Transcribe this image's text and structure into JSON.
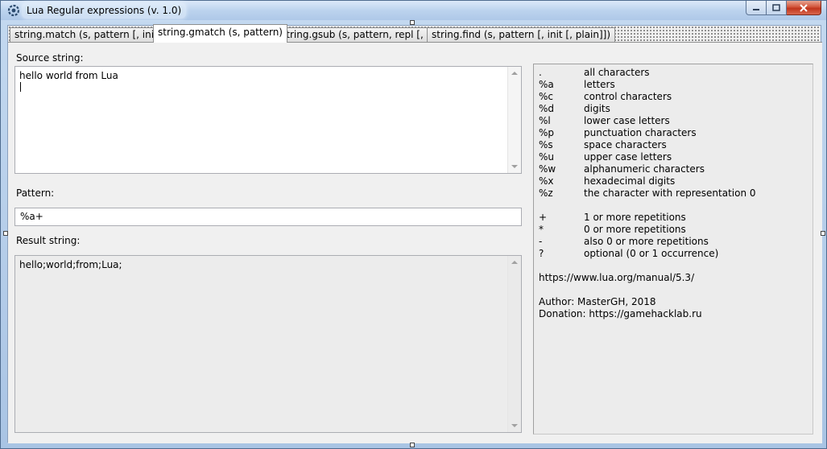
{
  "window": {
    "title": "Lua Regular expressions (v. 1.0)"
  },
  "tabs": [
    {
      "label": "string.match (s, pattern [, init])",
      "active": false
    },
    {
      "label": "string.gmatch (s, pattern)",
      "active": true
    },
    {
      "label": "string.gsub (s, pattern, repl [, n])",
      "active": false
    },
    {
      "label": "string.find (s, pattern [, init [, plain]])",
      "active": false
    }
  ],
  "source": {
    "label": "Source string:",
    "value": "hello world from Lua"
  },
  "pattern": {
    "label": "Pattern:",
    "value": "%a+"
  },
  "result": {
    "label": "Result string:",
    "value": "hello;world;from;Lua;"
  },
  "help": {
    "classes": [
      {
        "sym": ".",
        "desc": "all characters"
      },
      {
        "sym": "%a",
        "desc": "letters"
      },
      {
        "sym": "%c",
        "desc": "control characters"
      },
      {
        "sym": "%d",
        "desc": "digits"
      },
      {
        "sym": "%l",
        "desc": "lower case letters"
      },
      {
        "sym": "%p",
        "desc": "punctuation characters"
      },
      {
        "sym": "%s",
        "desc": "space characters"
      },
      {
        "sym": "%u",
        "desc": "upper case letters"
      },
      {
        "sym": "%w",
        "desc": "alphanumeric characters"
      },
      {
        "sym": "%x",
        "desc": "hexadecimal digits"
      },
      {
        "sym": "%z",
        "desc": "the character with representation 0"
      }
    ],
    "repetitions": [
      {
        "sym": "+",
        "desc": "1 or more repetitions"
      },
      {
        "sym": "*",
        "desc": "0 or more repetitions"
      },
      {
        "sym": "-",
        "desc": "also 0 or more repetitions"
      },
      {
        "sym": "?",
        "desc": "optional (0 or 1 occurrence)"
      }
    ],
    "manual_url": "https://www.lua.org/manual/5.3/",
    "author": "Author: MasterGH, 2018",
    "donation": "Donation: https://gamehacklab.ru"
  }
}
